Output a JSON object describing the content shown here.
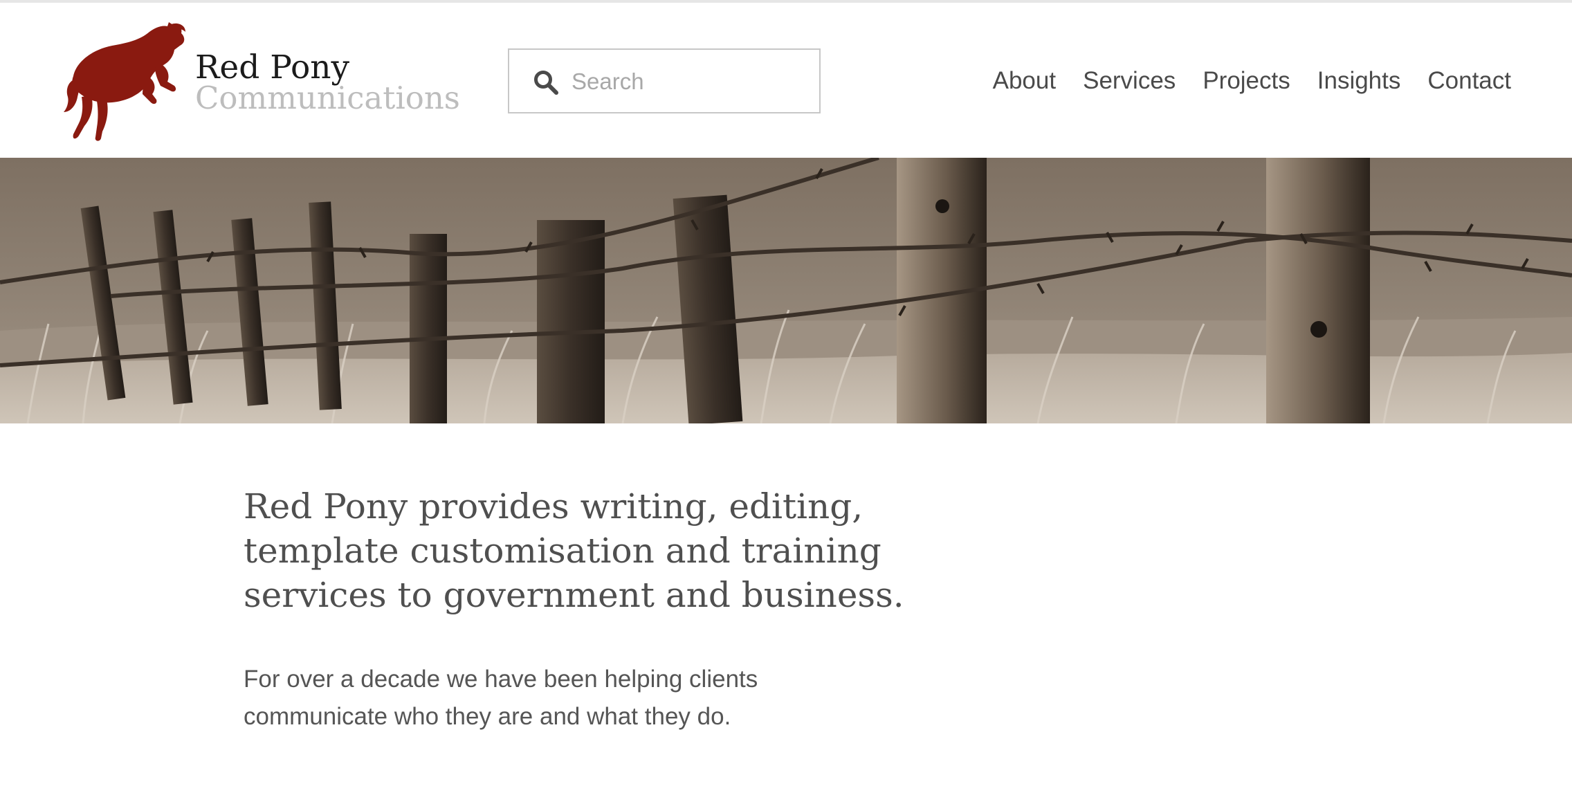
{
  "header": {
    "logo": {
      "name": "Red Pony",
      "subtitle": "Communications",
      "icon": "leaping-pony-icon",
      "color": "#8a1a10"
    },
    "search": {
      "placeholder": "Search",
      "value": "",
      "icon": "search-icon"
    },
    "nav": [
      {
        "label": "About"
      },
      {
        "label": "Services"
      },
      {
        "label": "Projects"
      },
      {
        "label": "Insights"
      },
      {
        "label": "Contact"
      }
    ]
  },
  "banner": {
    "image": "sepia-barbed-wire-fence-in-grass-photo"
  },
  "content": {
    "lead": "Red Pony provides writing, editing, template customisation and training services to government and business.",
    "paragraph": "For over a decade we have been helping clients communicate who they are and what they do."
  },
  "colors": {
    "brand": "#8a1a10",
    "text": "#4f4f4f",
    "muted": "#bdbdbd",
    "banner_tone": "#8a7d70"
  }
}
